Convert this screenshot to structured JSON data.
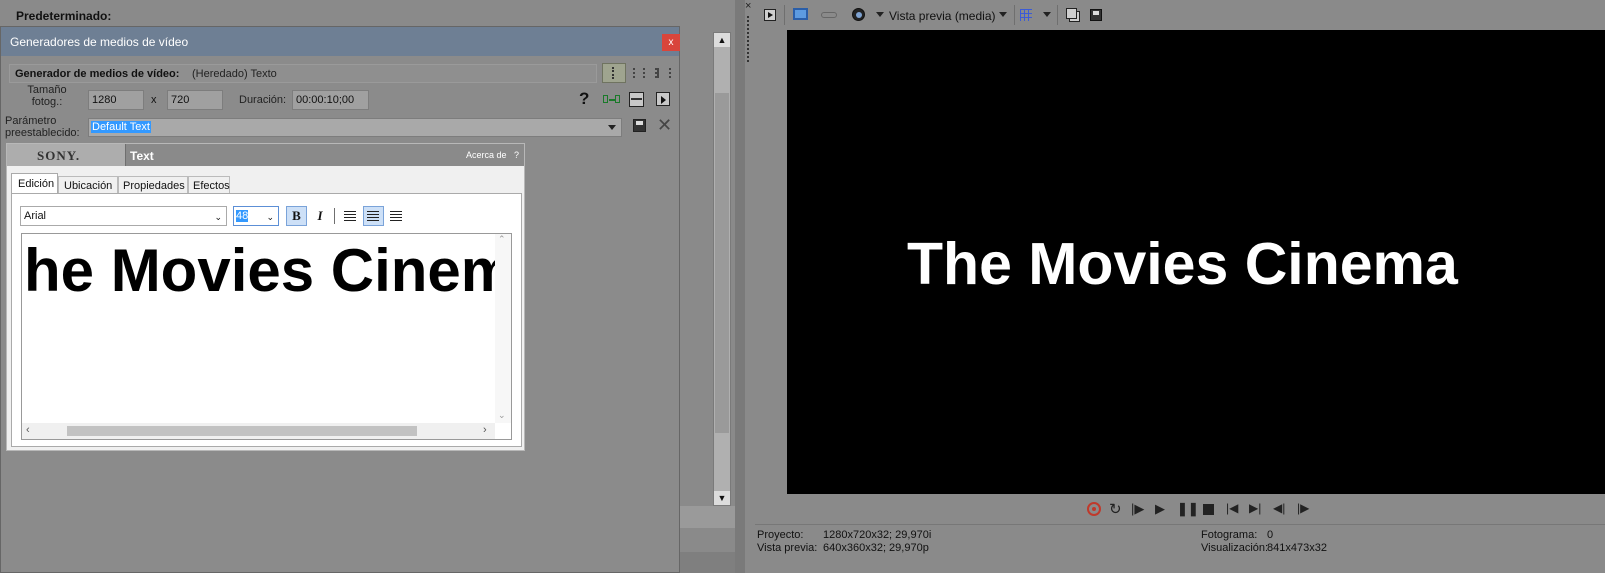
{
  "background_panel": {
    "label": "Predeterminado:"
  },
  "dialog": {
    "title": "Generadores de medios de vídeo",
    "close_label": "x",
    "generator_label": "Generador de medios de vídeo:",
    "generator_value": "(Heredado) Texto",
    "frame_size_label": "Tamaño fotog.:",
    "width": "1280",
    "times": "x",
    "height": "720",
    "duration_label": "Duración:",
    "duration_value": "00:00:10;00",
    "help_label": "?",
    "preset_label": "Parámetro preestablecido:",
    "preset_value": "Default Text"
  },
  "plugin": {
    "brand": "SONY.",
    "name": "Text",
    "about": "Acerca de",
    "help": "?",
    "tabs": [
      "Edición",
      "Ubicación",
      "Propiedades",
      "Efectos"
    ],
    "font": "Arial",
    "font_size": "48",
    "bold": "B",
    "italic": "I",
    "editor_text": "he Movies Cinem"
  },
  "preview": {
    "mode_label": "Vista previa (media)",
    "canvas_text": "The Movies Cinema",
    "status": {
      "project_label": "Proyecto:",
      "project_value": "1280x720x32; 29,970i",
      "preview_label": "Vista previa:",
      "preview_value": "640x360x32; 29,970p",
      "frame_label": "Fotograma:",
      "frame_value": "0",
      "display_label": "Visualización:",
      "display_value": "841x473x32"
    }
  },
  "colors": {
    "app_bg": "#8a8a8a",
    "dialog_title": "#6e7f94",
    "preview_bg": "#000000",
    "selection": "#3399ff",
    "close_red": "#d9453b"
  }
}
